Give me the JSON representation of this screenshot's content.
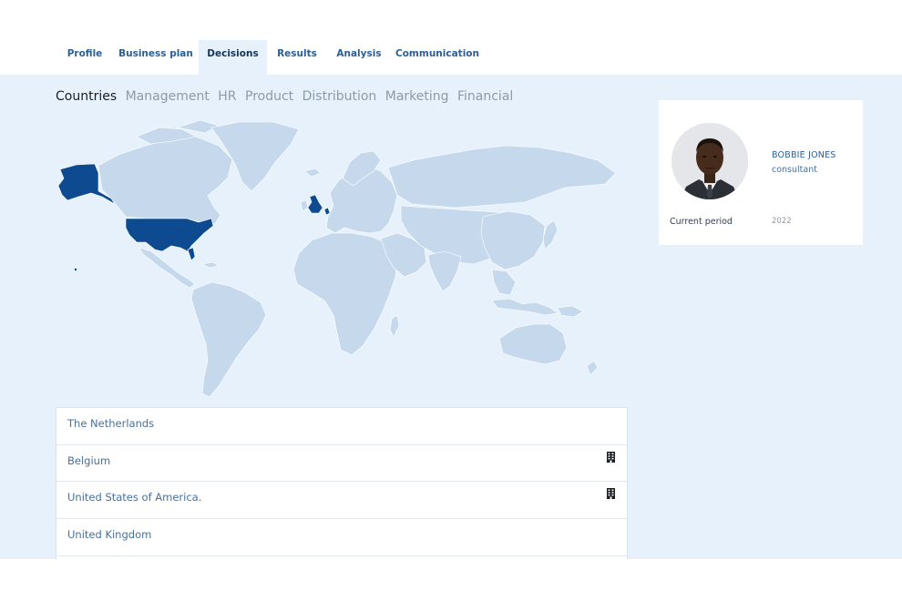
{
  "nav": {
    "tabs": [
      {
        "label": "Profile",
        "active": false
      },
      {
        "label": "Business plan",
        "active": false
      },
      {
        "label": "Decisions",
        "active": true
      },
      {
        "label": "Results",
        "active": false
      },
      {
        "label": "Analysis",
        "active": false
      },
      {
        "label": "Communication",
        "active": false
      }
    ]
  },
  "subtabs": [
    {
      "label": "Countries",
      "active": true
    },
    {
      "label": "Management",
      "active": false
    },
    {
      "label": "HR",
      "active": false
    },
    {
      "label": "Product",
      "active": false
    },
    {
      "label": "Distribution",
      "active": false
    },
    {
      "label": "Marketing",
      "active": false
    },
    {
      "label": "Financial",
      "active": false
    }
  ],
  "map": {
    "land_color": "#c6d9ec",
    "highlight_color": "#0d4a8f",
    "highlighted_countries": [
      "United States of America",
      "United Kingdom"
    ]
  },
  "countries": [
    {
      "name": "The Netherlands",
      "icon": null
    },
    {
      "name": "Belgium",
      "icon": "building-icon"
    },
    {
      "name": "United States of America.",
      "icon": "building-icon"
    },
    {
      "name": "United Kingdom",
      "icon": null
    }
  ],
  "profile": {
    "name": "BOBBIE JONES",
    "role": "consultant",
    "period_label": "Current period",
    "period_value": "2022"
  },
  "colors": {
    "accent": "#2b5f96",
    "panel_bg": "#e6f1fc"
  }
}
